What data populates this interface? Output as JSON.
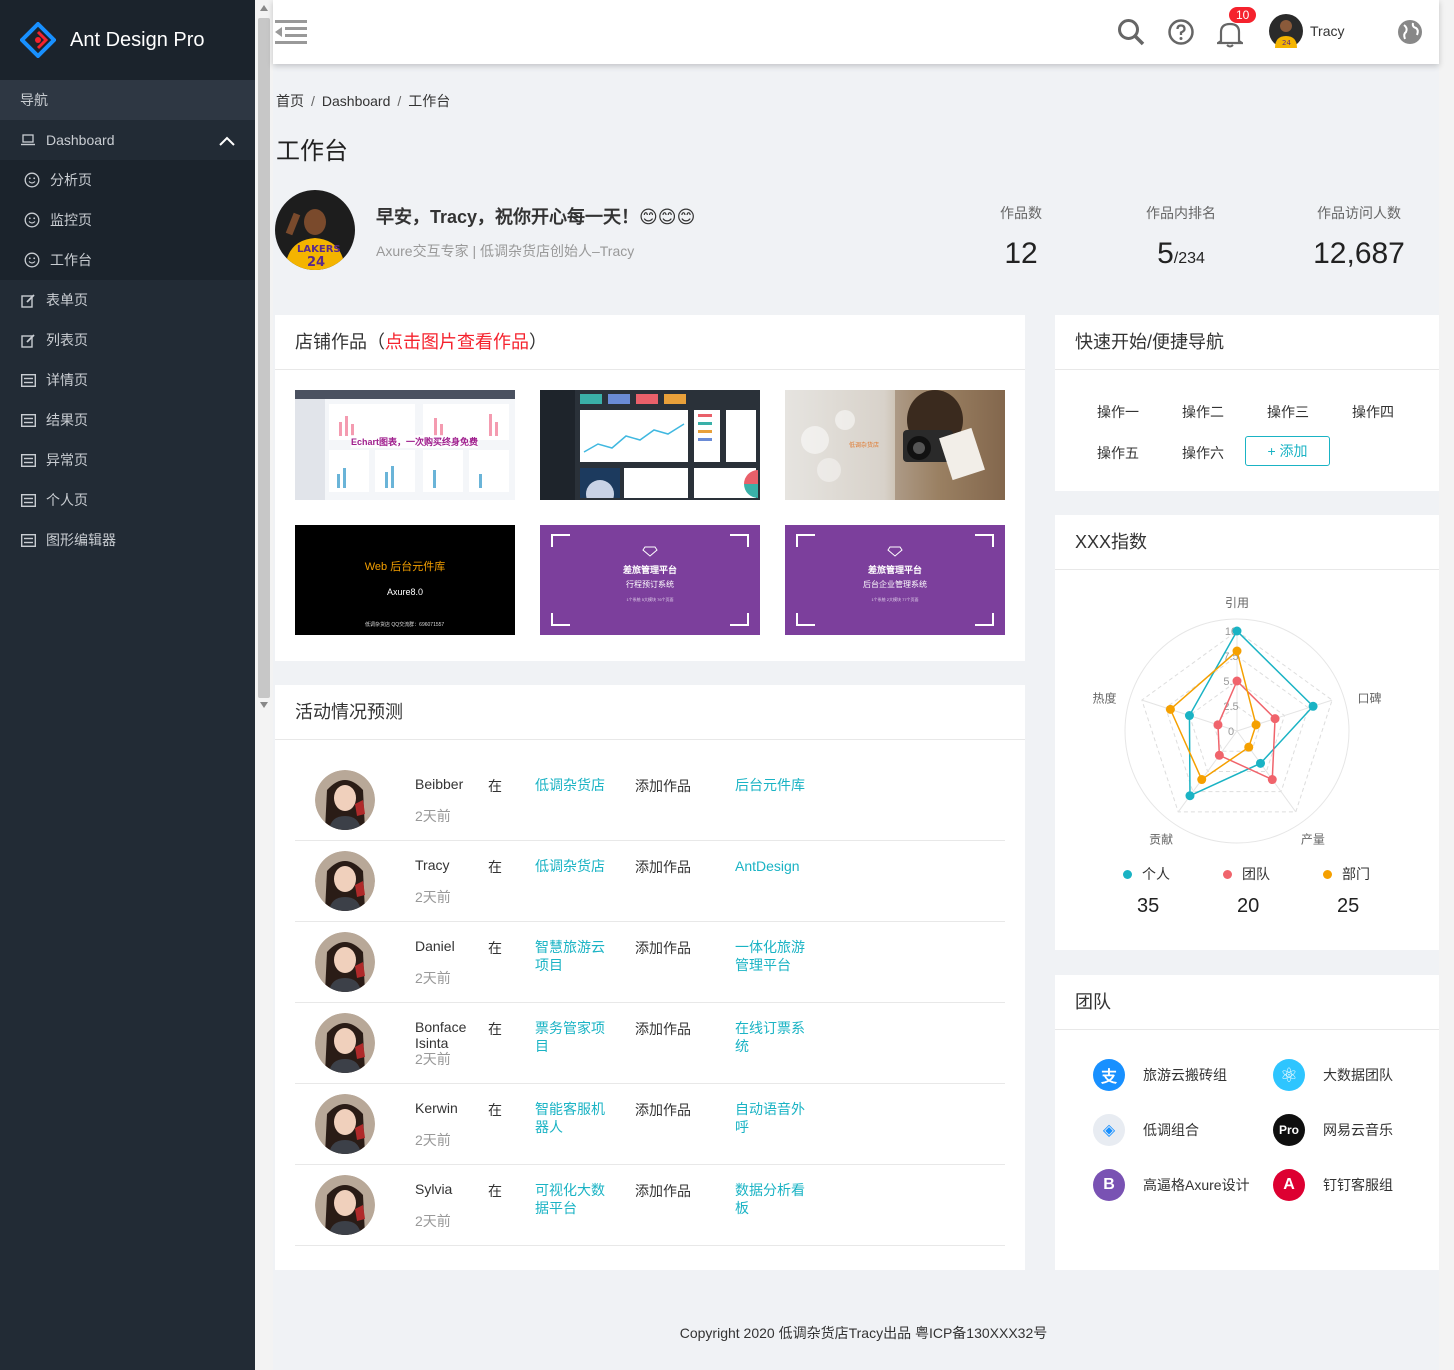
{
  "app": {
    "title": "Ant Design Pro"
  },
  "sidebar": {
    "nav_header": "导航",
    "dashboard": "Dashboard",
    "sub_items": [
      {
        "label": "分析页"
      },
      {
        "label": "监控页"
      },
      {
        "label": "工作台"
      }
    ],
    "items": [
      {
        "label": "表单页"
      },
      {
        "label": "列表页"
      },
      {
        "label": "详情页"
      },
      {
        "label": "结果页"
      },
      {
        "label": "异常页"
      },
      {
        "label": "个人页"
      },
      {
        "label": "图形编辑器"
      }
    ]
  },
  "header": {
    "notification_count": "10",
    "user_name": "Tracy"
  },
  "breadcrumb": [
    "首页",
    "Dashboard",
    "工作台"
  ],
  "page_title": "工作台",
  "profile": {
    "greeting": "早安，Tracy，祝你开心每一天！😊😊😊",
    "subtitle": "Axure交互专家 | 低调杂货店创始人–Tracy"
  },
  "stats": [
    {
      "label": "作品数",
      "value": "12"
    },
    {
      "label": "作品内排名",
      "value": "5",
      "suffix": "/234"
    },
    {
      "label": "作品访问人数",
      "value": "12,687"
    }
  ],
  "works": {
    "title_main": "店铺作品（",
    "title_highlight": "点击图片查看作品",
    "title_end": "）",
    "thumbs": [
      {
        "caption": "Echart图表，一次购买终身免费"
      },
      {
        "caption": ""
      },
      {
        "caption": ""
      },
      {
        "caption": "Web 后台元件库",
        "sub": "Axure8.0",
        "foot": "低调杂货店   QQ交流群：696071557"
      },
      {
        "caption": "差旅管理平台",
        "sub": "行程预订系统",
        "foot": "1个系统   5大模块   76个页面"
      },
      {
        "caption": "差旅管理平台",
        "sub": "后台企业管理系统",
        "foot": "1个系统   2大模块   77个页面"
      }
    ]
  },
  "activity": {
    "title": "活动情况预测",
    "in_text": "在",
    "action": "添加作品",
    "rows": [
      {
        "name": "Beibber",
        "time": "2天前",
        "project": "低调杂货店",
        "target": "后台元件库"
      },
      {
        "name": "Tracy",
        "time": "2天前",
        "project": "低调杂货店",
        "target": "AntDesign"
      },
      {
        "name": "Daniel",
        "time": "2天前",
        "project": "智慧旅游云项目",
        "target": "一体化旅游管理平台"
      },
      {
        "name": "Bonface Isinta",
        "time": "2天前",
        "project": "票务管家项目",
        "target": "在线订票系统"
      },
      {
        "name": "Kerwin",
        "time": "2天前",
        "project": "智能客服机器人",
        "target": "自动语音外呼"
      },
      {
        "name": "Sylvia",
        "time": "2天前",
        "project": "可视化大数据平台",
        "target": "数据分析看板"
      }
    ]
  },
  "quick": {
    "title": "快速开始/便捷导航",
    "ops": [
      "操作一",
      "操作二",
      "操作三",
      "操作四",
      "操作五",
      "操作六"
    ],
    "add_label": "+ 添加"
  },
  "chart_data": {
    "type": "radar",
    "title": "XXX指数",
    "indicators": [
      "引用",
      "口碑",
      "产量",
      "贡献",
      "热度"
    ],
    "ticks": [
      "0",
      "2.5",
      "5.0",
      "7.5",
      "10"
    ],
    "max": 10,
    "series": [
      {
        "name": "个人",
        "color": "#1ab3c4",
        "values": [
          10,
          8,
          4,
          8,
          5
        ],
        "total": "35"
      },
      {
        "name": "团队",
        "color": "#f0646c",
        "values": [
          5,
          4,
          6,
          3,
          2
        ],
        "total": "20"
      },
      {
        "name": "部门",
        "color": "#f5a000",
        "values": [
          8,
          2,
          2,
          6,
          7
        ],
        "total": "25"
      }
    ]
  },
  "team": {
    "title": "团队",
    "members": [
      {
        "name": "旅游云搬砖组",
        "icon": "alipay-icon",
        "color": "#1890ff",
        "glyph": "支"
      },
      {
        "name": "大数据团队",
        "icon": "react-icon",
        "color": "#2ec5ff",
        "glyph": "⚛"
      },
      {
        "name": "低调组合",
        "icon": "antd-icon",
        "color": "#e8ecf2",
        "glyph": "◈"
      },
      {
        "name": "网易云音乐",
        "icon": "pro-icon",
        "color": "#0f0f0f",
        "glyph": "Pro"
      },
      {
        "name": "高逼格Axure设计",
        "icon": "bootstrap-icon",
        "color": "#7952b3",
        "glyph": "B"
      },
      {
        "name": "钉钉客服组",
        "icon": "angular-icon",
        "color": "#dd0031",
        "glyph": "A"
      }
    ]
  },
  "footer": "Copyright  2020 低调杂货店Tracy出品 粤ICP备130XXX32号"
}
